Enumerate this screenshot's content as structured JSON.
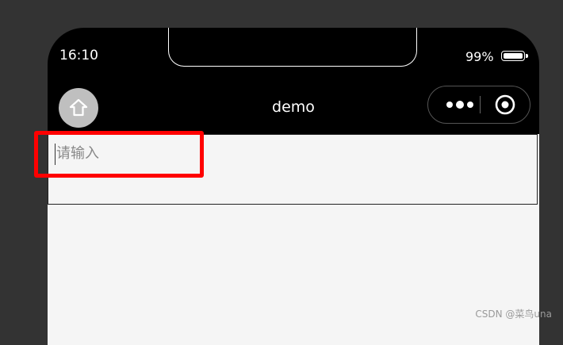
{
  "status_bar": {
    "time": "16:10",
    "battery": "99%"
  },
  "nav_bar": {
    "title": "demo",
    "home_icon": "home-icon",
    "menu_icon": "more-dots-icon",
    "close_icon": "target-close-icon"
  },
  "form": {
    "input_placeholder": "请输入",
    "input_value": ""
  },
  "watermark": "CSDN @菜鸟una",
  "colors": {
    "background": "#333333",
    "phone": "#000000",
    "content": "#f5f5f5",
    "highlight": "#ff0000"
  }
}
